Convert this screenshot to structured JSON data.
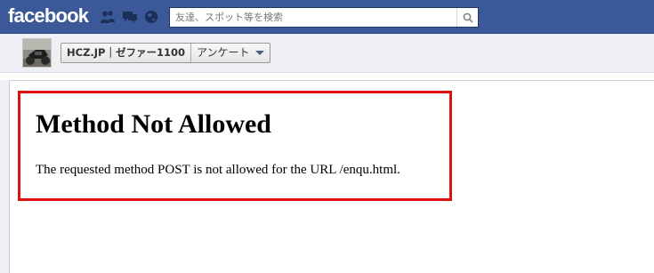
{
  "topbar": {
    "logo": "facebook",
    "search_placeholder": "友達、スポット等を検索",
    "icons": [
      "friend-requests-icon",
      "messages-icon",
      "notifications-globe-icon",
      "search-icon"
    ],
    "bg_color": "#3b5998"
  },
  "subheader": {
    "page_name": "HCZ.JP｜ゼファー1100",
    "tab_label": "アンケート",
    "avatar": "motorcycle-thumbnail"
  },
  "content": {
    "error_title": "Method Not Allowed",
    "error_message": "The requested method POST is not allowed for the URL /enqu.html.",
    "highlight_color": "#e01010"
  }
}
